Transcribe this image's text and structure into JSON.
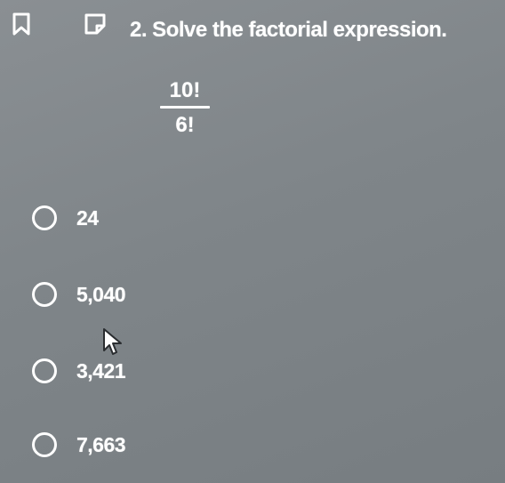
{
  "toolbar": {
    "bookmark_icon": "bookmark-icon",
    "note_icon": "note-icon"
  },
  "question": {
    "title": "2. Solve the factorial expression.",
    "numerator": "10!",
    "denominator": "6!"
  },
  "options": [
    {
      "label": "24"
    },
    {
      "label": "5,040"
    },
    {
      "label": "3,421"
    },
    {
      "label": "7,663"
    }
  ],
  "colors": {
    "background": "#80868a",
    "text": "#ffffff"
  }
}
